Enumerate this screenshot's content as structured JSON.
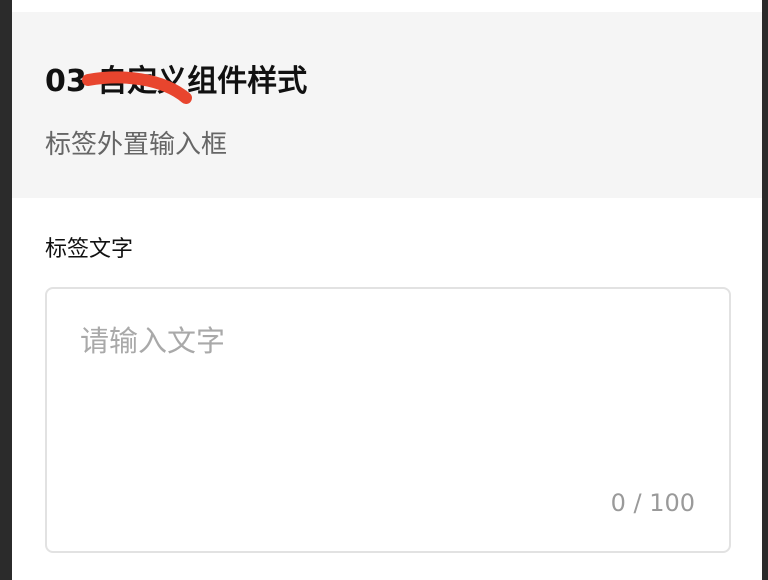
{
  "section": {
    "title": "03 自定义组件样式",
    "subtitle": "标签外置输入框"
  },
  "field": {
    "label": "标签文字",
    "value": "",
    "placeholder": "请输入文字",
    "counter": "0 / 100"
  },
  "colors": {
    "header_background": "#f5f5f5",
    "redaction_mark": "#e8452e",
    "border": "#e2e2e2",
    "placeholder": "#a9a9a9"
  },
  "icons": {
    "redaction": "red-strikethrough-scribble"
  }
}
